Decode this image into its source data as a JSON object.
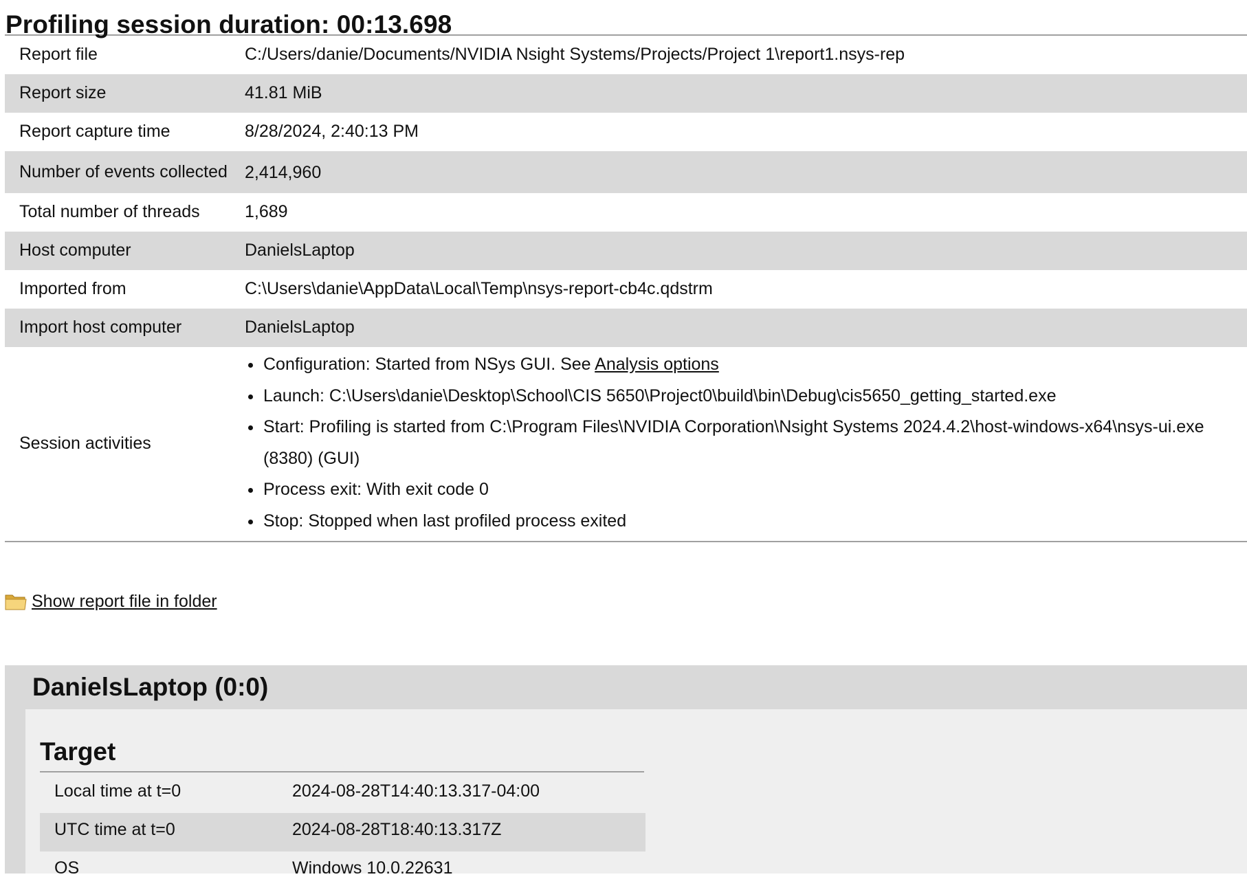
{
  "title": "Profiling session duration: 00:13.698",
  "rows": [
    {
      "key": "Report file",
      "value": "C:/Users/danie/Documents/NVIDIA Nsight Systems/Projects/Project 1\\report1.nsys-rep"
    },
    {
      "key": "Report size",
      "value": "41.81 MiB"
    },
    {
      "key": "Report capture time",
      "value": "8/28/2024, 2:40:13 PM"
    },
    {
      "key": "Number of events collected",
      "value": "2,414,960"
    },
    {
      "key": "Total number of threads",
      "value": "1,689"
    },
    {
      "key": "Host computer",
      "value": "DanielsLaptop"
    },
    {
      "key": "Imported from",
      "value": "C:\\Users\\danie\\AppData\\Local\\Temp\\nsys-report-cb4c.qdstrm"
    },
    {
      "key": "Import host computer",
      "value": "DanielsLaptop"
    }
  ],
  "session": {
    "key": "Session activities",
    "config_prefix": "Configuration: Started from NSys GUI. See ",
    "config_link": "Analysis options",
    "launch": "Launch: C:\\Users\\danie\\Desktop\\School\\CIS 5650\\Project0\\build\\bin\\Debug\\cis5650_getting_started.exe",
    "start": "Start: Profiling is started from C:\\Program Files\\NVIDIA Corporation\\Nsight Systems 2024.4.2\\host-windows-x64\\nsys-ui.exe (8380) (GUI)",
    "exit": "Process exit: With exit code 0",
    "stop": "Stop: Stopped when last profiled process exited"
  },
  "show_folder_link": "Show report file in folder",
  "folder_icon": "folder-icon",
  "host_section": {
    "title": "DanielsLaptop (0:0)",
    "target_title": "Target",
    "rows": [
      {
        "key": "Local time at t=0",
        "value": "2024-08-28T14:40:13.317-04:00"
      },
      {
        "key": "UTC time at t=0",
        "value": "2024-08-28T18:40:13.317Z"
      },
      {
        "key": "OS",
        "value": "Windows 10.0.22631"
      }
    ]
  },
  "colors": {
    "row_alt": "#d9d9d9",
    "section_bg": "#efefef",
    "rule": "#a0a0a0"
  }
}
